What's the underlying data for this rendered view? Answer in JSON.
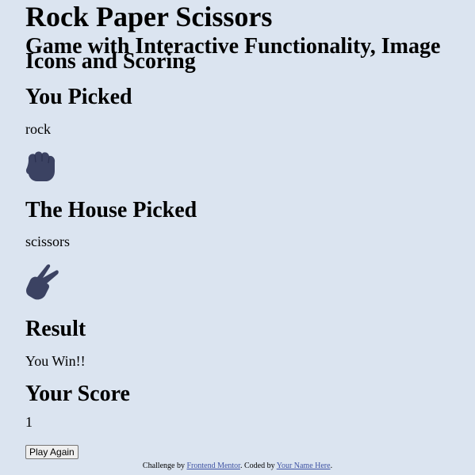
{
  "game": {
    "title": "Rock Paper Scissors",
    "subtitle": "Game with Interactive Functionality, Image Icons and Scoring"
  },
  "player": {
    "heading": "You Picked",
    "choice": "rock",
    "icon": "rock-hand-icon"
  },
  "house": {
    "heading": "The House Picked",
    "choice": "scissors",
    "icon": "scissors-hand-icon"
  },
  "result": {
    "heading": "Result",
    "text": "You Win!!"
  },
  "score": {
    "heading": "Your Score",
    "value": "1"
  },
  "actions": {
    "play_again_label": "Play Again"
  },
  "attribution": {
    "prefix": "Challenge by ",
    "link1_text": "Frontend Mentor",
    "middle": ". Coded by ",
    "link2_text": "Your Name Here",
    "suffix": "."
  },
  "colors": {
    "background": "#dbe4f0",
    "icon": "#3b4262",
    "link": "#3e52a3"
  }
}
